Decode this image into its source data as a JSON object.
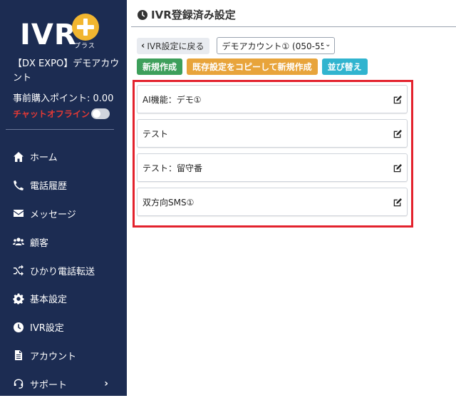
{
  "app": {
    "logo_text": "IVR",
    "logo_sub": "プラス"
  },
  "sidebar": {
    "account_name": "【DX EXPO】デモアカウント",
    "points": "事前購入ポイント: 0.00",
    "chat_status": "チャットオフライン",
    "chat_online": false,
    "items": [
      {
        "label": "ホーム",
        "icon": "home-icon"
      },
      {
        "label": "電話履歴",
        "icon": "phone-icon"
      },
      {
        "label": "メッセージ",
        "icon": "envelope-icon"
      },
      {
        "label": "顧客",
        "icon": "users-icon"
      },
      {
        "label": "ひかり電話転送",
        "icon": "shuffle-icon"
      },
      {
        "label": "基本設定",
        "icon": "gear-icon"
      },
      {
        "label": "IVR設定",
        "icon": "clock-icon"
      },
      {
        "label": "アカウント",
        "icon": "document-icon"
      },
      {
        "label": "サポート",
        "icon": "headset-icon"
      }
    ]
  },
  "page": {
    "title": "IVR登録済み設定",
    "back_label": "IVR設定に戻る",
    "account_select": "デモアカウント① (050-55",
    "buttons": {
      "new": "新規作成",
      "copy_new": "既存設定をコピーして新規作成",
      "sort": "並び替え"
    },
    "ivr_items": [
      {
        "label": "AI機能：デモ①"
      },
      {
        "label": "テスト"
      },
      {
        "label": "テスト：留守番"
      },
      {
        "label": "双方向SMS①"
      }
    ]
  },
  "colors": {
    "sidebar_bg": "#1c2c52",
    "accent_yellow": "#f2b630",
    "btn_green": "#3d9f5b",
    "btn_orange": "#e8a43b",
    "btn_teal": "#31b4cf",
    "highlight_red": "#e3222d",
    "offline_red": "#e53935"
  }
}
